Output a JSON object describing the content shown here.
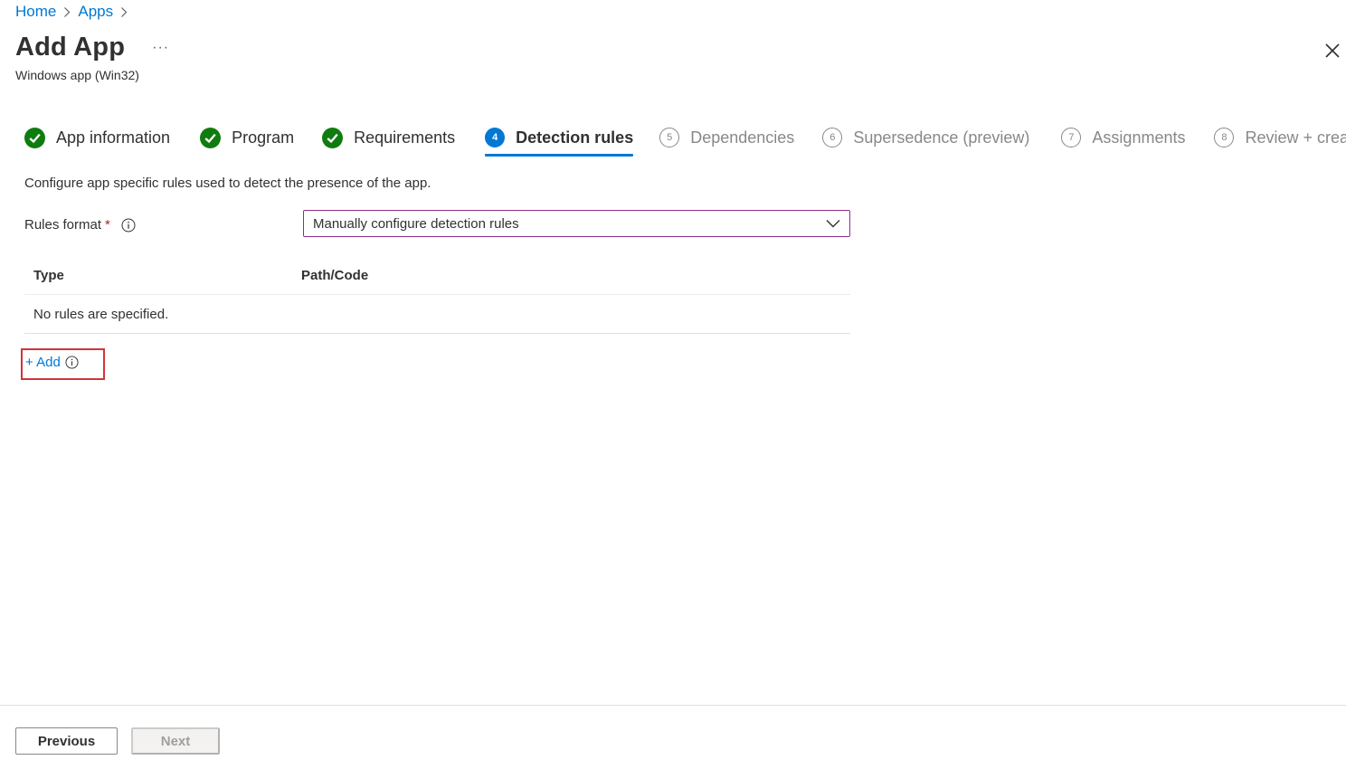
{
  "breadcrumb": {
    "items": [
      "Home",
      "Apps"
    ]
  },
  "header": {
    "title": "Add App",
    "more": "···",
    "subtitle": "Windows app (Win32)"
  },
  "steps": [
    {
      "number": "1",
      "label": "App information",
      "status": "done"
    },
    {
      "number": "2",
      "label": "Program",
      "status": "done"
    },
    {
      "number": "3",
      "label": "Requirements",
      "status": "done"
    },
    {
      "number": "4",
      "label": "Detection rules",
      "status": "active"
    },
    {
      "number": "5",
      "label": "Dependencies",
      "status": "pending"
    },
    {
      "number": "6",
      "label": "Supersedence (preview)",
      "status": "pending"
    },
    {
      "number": "7",
      "label": "Assignments",
      "status": "pending"
    },
    {
      "number": "8",
      "label": "Review + create",
      "status": "pending"
    }
  ],
  "main": {
    "description": "Configure app specific rules used to detect the presence of the app.",
    "rules_format": {
      "label": "Rules format",
      "required_mark": "*",
      "value": "Manually configure detection rules"
    },
    "table": {
      "columns": [
        "Type",
        "Path/Code"
      ],
      "empty_text": "No rules are specified."
    },
    "add_label": "+ Add"
  },
  "footer": {
    "previous_label": "Previous",
    "next_label": "Next"
  },
  "colors": {
    "accent": "#0078d4",
    "success": "#107c10",
    "highlight": "#d13438"
  }
}
